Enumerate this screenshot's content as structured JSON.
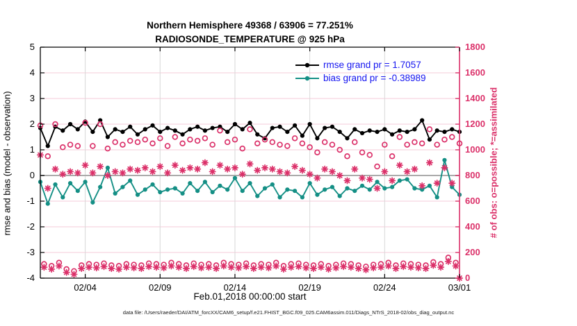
{
  "title_line1": "Northern Hemisphere 49368 / 63906 = 77.251%",
  "title_line2": "RADIOSONDE_TEMPERATURE @ 925 hPa",
  "footer_text": "data file: /Users/raeder/DAI/ATM_forcXX/CAM6_setup/f.e21.FHIST_BGC.f09_025.CAM6assim.011/Diags_NTrS_2018-02/obs_diag_output.nc",
  "colors": {
    "rmse_line": "#000000",
    "bias_line": "#148F85",
    "obs_accent": "#DB3069",
    "legend_text": "#1414F0",
    "grid_pink": "#F5CBD9",
    "grid_gray": "#D8D8D8",
    "zero_line": "#ABABAB"
  },
  "chart_data": {
    "type": "line",
    "title": "Northern Hemisphere 49368 / 63906 = 77.251% | RADIOSONDE_TEMPERATURE @ 925 hPa",
    "xlabel": "Feb.01,2018 00:00:00 start",
    "ylabel_left": "rmse and bias (model - observation)",
    "ylabel_right": "# of obs: o=possible; *=assimilated",
    "xlim_days": [
      0,
      28
    ],
    "ylim_left": [
      -4,
      5
    ],
    "ylim_right": [
      0,
      1800
    ],
    "grid": "on",
    "legend_position": "top-right-inside",
    "x_ticks": [
      {
        "day": 3,
        "label": "02/04"
      },
      {
        "day": 8,
        "label": "02/09"
      },
      {
        "day": 13,
        "label": "02/14"
      },
      {
        "day": 18,
        "label": "02/19"
      },
      {
        "day": 23,
        "label": "02/24"
      },
      {
        "day": 28,
        "label": "03/01"
      }
    ],
    "y_ticks_left": [
      {
        "v": 5,
        "label": "5"
      },
      {
        "v": 4,
        "label": "4"
      },
      {
        "v": 3,
        "label": "3"
      },
      {
        "v": 2,
        "label": "2"
      },
      {
        "v": 1,
        "label": "1"
      },
      {
        "v": 0,
        "label": "0"
      },
      {
        "v": -1,
        "label": "-1"
      },
      {
        "v": -2,
        "label": "-2"
      },
      {
        "v": -3,
        "label": "-3"
      },
      {
        "v": -4,
        "label": "-4"
      }
    ],
    "y_ticks_right": [
      {
        "v": 1800,
        "label": "1800"
      },
      {
        "v": 1600,
        "label": "1600"
      },
      {
        "v": 1400,
        "label": "1400"
      },
      {
        "v": 1200,
        "label": "1200"
      },
      {
        "v": 1000,
        "label": "1000"
      },
      {
        "v": 800,
        "label": "800"
      },
      {
        "v": 600,
        "label": "600"
      },
      {
        "v": 400,
        "label": "400"
      },
      {
        "v": 200,
        "label": "200"
      },
      {
        "v": 0,
        "label": "0"
      }
    ],
    "zero_line_left_value": 0,
    "legend": [
      {
        "label": "rmse grand pr = 1.7057",
        "series": "rmse",
        "color": "#000000"
      },
      {
        "label": "bias grand pr = -0.38989",
        "series": "bias",
        "color": "#148F85"
      }
    ],
    "series": [
      {
        "name": "rmse",
        "axis": "left",
        "style": "line-dot",
        "color": "#000000",
        "x0": 0,
        "dx": 0.5,
        "values": [
          1.85,
          1.15,
          1.9,
          1.75,
          2.0,
          1.8,
          2.1,
          1.7,
          2.15,
          1.5,
          1.8,
          1.7,
          1.9,
          1.6,
          1.8,
          1.95,
          1.7,
          1.85,
          1.75,
          1.6,
          1.8,
          1.9,
          1.75,
          1.85,
          1.9,
          1.7,
          2.0,
          1.8,
          2.05,
          1.6,
          1.45,
          1.85,
          1.9,
          1.7,
          1.95,
          1.55,
          2.0,
          1.45,
          1.85,
          1.9,
          1.7,
          1.45,
          1.8,
          1.65,
          1.75,
          1.7,
          1.8,
          1.6,
          1.75,
          1.7,
          1.8,
          2.15,
          1.4,
          1.75,
          1.7,
          1.8,
          1.7
        ]
      },
      {
        "name": "bias",
        "axis": "left",
        "style": "line-dot",
        "color": "#148F85",
        "x0": 0,
        "dx": 0.5,
        "values": [
          -0.25,
          -1.1,
          -0.35,
          -0.85,
          -0.3,
          -0.6,
          -0.25,
          -1.05,
          -0.45,
          0.3,
          -0.7,
          -0.45,
          -0.2,
          -0.75,
          -0.55,
          -0.35,
          -0.65,
          -0.55,
          -0.5,
          -0.7,
          -0.3,
          -0.6,
          -0.25,
          -0.65,
          -0.4,
          -0.55,
          -0.1,
          -0.6,
          -0.3,
          -0.8,
          -0.5,
          -0.35,
          -0.85,
          -0.55,
          -0.6,
          -0.85,
          -0.3,
          -0.75,
          -0.55,
          -0.45,
          -0.8,
          -0.5,
          -0.6,
          -0.4,
          -0.55,
          -0.25,
          -0.5,
          -0.45,
          -0.2,
          -0.15,
          -0.5,
          -0.55,
          -0.4,
          -0.85,
          0.6,
          -0.45,
          -0.75
        ]
      },
      {
        "name": "possible_00_12Z",
        "axis": "right",
        "style": "circle",
        "color": "#DB3069",
        "x0": 0,
        "dx": 0.5,
        "values": [
          1190,
          950,
          1200,
          1020,
          1040,
          1030,
          1210,
          1030,
          1200,
          1010,
          1060,
          1040,
          1070,
          1060,
          1080,
          1050,
          1090,
          1030,
          1100,
          1050,
          1080,
          1070,
          1090,
          1040,
          1150,
          1060,
          1080,
          1010,
          1160,
          1050,
          1080,
          1060,
          1040,
          1030,
          1090,
          1050,
          1020,
          980,
          1060,
          1040,
          1000,
          950,
          1060,
          980,
          960,
          870,
          1040,
          950,
          1100,
          1040,
          1060,
          1050,
          1160,
          1040,
          1080,
          1100,
          1050
        ]
      },
      {
        "name": "assimilated_00_12Z",
        "axis": "right",
        "style": "asterisk",
        "color": "#DB3069",
        "x0": 0,
        "dx": 0.5,
        "values": [
          960,
          700,
          850,
          810,
          830,
          820,
          880,
          820,
          870,
          800,
          830,
          820,
          850,
          840,
          860,
          830,
          870,
          820,
          880,
          840,
          860,
          850,
          900,
          830,
          880,
          850,
          860,
          810,
          890,
          840,
          860,
          850,
          830,
          820,
          870,
          840,
          810,
          780,
          850,
          830,
          800,
          760,
          850,
          780,
          770,
          700,
          830,
          760,
          880,
          830,
          850,
          720,
          900,
          740,
          860,
          740,
          0
        ]
      },
      {
        "name": "possible_06_18Z",
        "axis": "right",
        "style": "circle",
        "color": "#DB3069",
        "x0": 0.25,
        "dx": 0.5,
        "values": [
          110,
          95,
          120,
          70,
          55,
          100,
          110,
          105,
          115,
          100,
          95,
          110,
          105,
          100,
          115,
          110,
          105,
          120,
          110,
          100,
          115,
          105,
          110,
          100,
          120,
          110,
          105,
          115,
          100,
          110,
          105,
          120,
          95,
          110,
          115,
          105,
          100,
          110,
          95,
          105,
          115,
          110,
          100,
          90,
          105,
          110,
          120,
          100,
          115,
          110,
          105,
          100,
          125,
          110,
          160,
          120
        ]
      },
      {
        "name": "assimilated_06_18Z",
        "axis": "right",
        "style": "asterisk",
        "color": "#DB3069",
        "x0": 0.25,
        "dx": 0.5,
        "values": [
          85,
          70,
          95,
          45,
          30,
          75,
          85,
          80,
          90,
          75,
          70,
          85,
          80,
          75,
          90,
          85,
          80,
          95,
          85,
          75,
          90,
          80,
          85,
          75,
          95,
          85,
          80,
          90,
          75,
          85,
          80,
          95,
          70,
          85,
          90,
          80,
          75,
          85,
          70,
          80,
          90,
          85,
          75,
          65,
          80,
          85,
          95,
          75,
          90,
          85,
          80,
          75,
          100,
          85,
          130,
          95
        ]
      }
    ]
  }
}
